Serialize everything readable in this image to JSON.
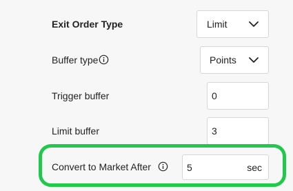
{
  "form": {
    "exit_order_type": {
      "label": "Exit Order Type",
      "value": "Limit"
    },
    "buffer_type": {
      "label": "Buffer type",
      "value": "Points"
    },
    "trigger_buffer": {
      "label": "Trigger buffer",
      "value": "0"
    },
    "limit_buffer": {
      "label": "Limit buffer",
      "value": "3"
    },
    "convert_to_market": {
      "label": "Convert to Market After",
      "value": "5",
      "unit": "sec"
    }
  },
  "colors": {
    "highlight": "#20c94b"
  },
  "icons": {
    "info": "info-icon",
    "dropdown": "chevron-down-icon"
  }
}
